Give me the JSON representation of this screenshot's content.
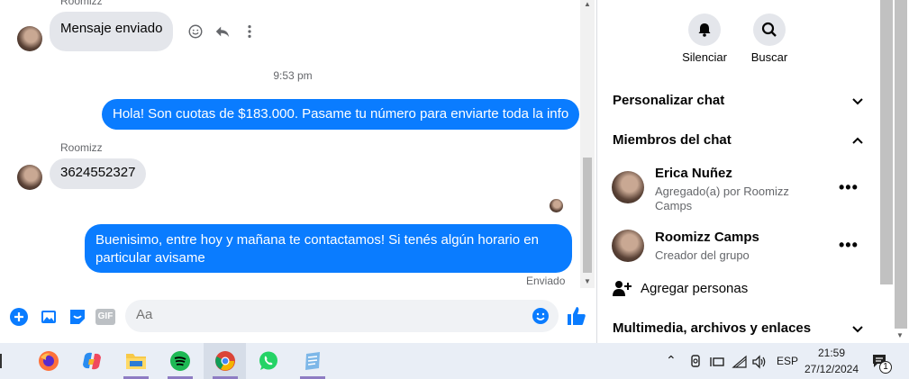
{
  "chat": {
    "sender_top": "Roomizz",
    "msg1": "Mensaje enviado",
    "time_sep": "9:53 pm",
    "msg2": "Hola! Son cuotas de $183.000. Pasame tu número para enviarte toda la info",
    "sender2": "Roomizz",
    "msg3": "3624552327",
    "msg4_line1": "Buenisimo, entre hoy y mañana te contactamos! Si tenés algún horario en",
    "msg4_line2": "particular avisame",
    "status": "Enviado",
    "input_placeholder": "Aa",
    "gif_label": "GIF",
    "colors": {
      "outgoing": "#0a7cff",
      "incoming": "#e4e6eb"
    }
  },
  "side": {
    "mute_label": "Silenciar",
    "search_label": "Buscar",
    "customize": "Personalizar chat",
    "members_title": "Miembros del chat",
    "members": [
      {
        "name": "Erica Nuñez",
        "sub": "Agregado(a) por Roomizz Camps"
      },
      {
        "name": "Roomizz Camps",
        "sub": "Creador del grupo"
      }
    ],
    "add_people": "Agregar personas",
    "media": "Multimedia, archivos y enlaces"
  },
  "taskbar": {
    "lang": "ESP",
    "time": "21:59",
    "date": "27/12/2024",
    "notif_count": "1"
  }
}
